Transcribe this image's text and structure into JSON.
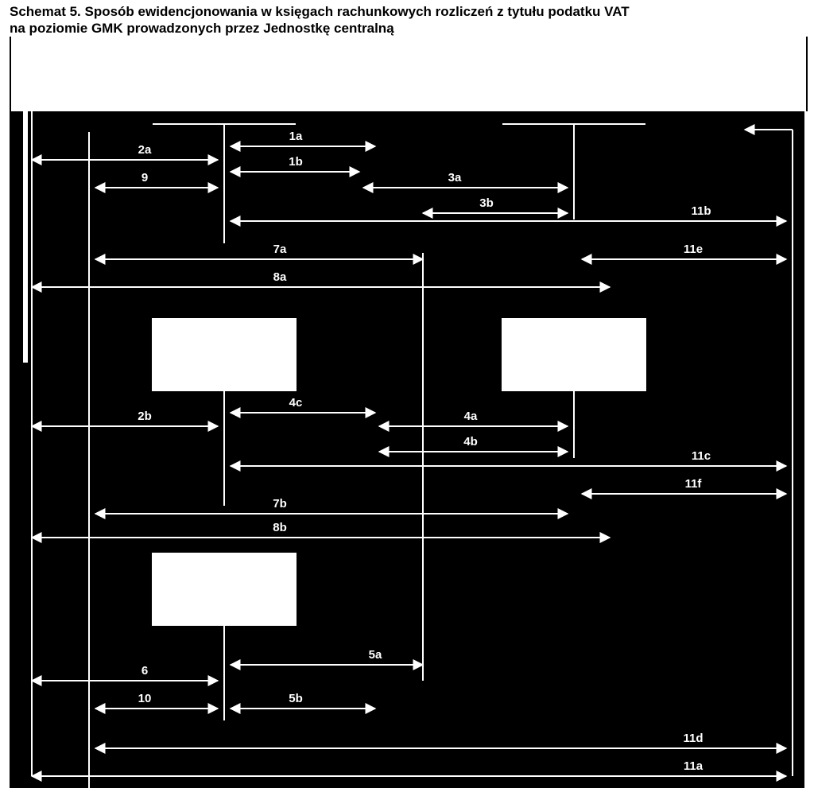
{
  "title_line1": "Schemat 5. Sposób ewidencjonowania w księgach rachunkowych rozliczeń z tytułu podatku VAT",
  "title_line2": "na poziomie GMK prowadzonych przez Jednostkę centralną",
  "labels": {
    "l1a": "1a",
    "l1b": "1b",
    "l2a": "2a",
    "l2b": "2b",
    "l3a": "3a",
    "l3b": "3b",
    "l4a": "4a",
    "l4b": "4b",
    "l4c": "4c",
    "l5a": "5a",
    "l5b": "5b",
    "l6": "6",
    "l7a": "7a",
    "l7b": "7b",
    "l8a": "8a",
    "l8b": "8b",
    "l9": "9",
    "l10": "10",
    "l11a": "11a",
    "l11b": "11b",
    "l11c": "11c",
    "l11d": "11d",
    "l11e": "11e",
    "l11f": "11f"
  }
}
